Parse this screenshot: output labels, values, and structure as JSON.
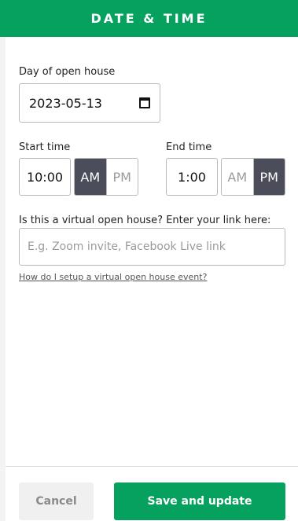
{
  "header": {
    "title": "DATE & TIME"
  },
  "day": {
    "label": "Day of open house",
    "value": "2023-05-13",
    "icon": "calendar-icon"
  },
  "start": {
    "label": "Start time",
    "value": "10:00",
    "am_label": "AM",
    "pm_label": "PM",
    "selected": "AM"
  },
  "end": {
    "label": "End time",
    "value": "1:00",
    "am_label": "AM",
    "pm_label": "PM",
    "selected": "PM"
  },
  "virtual": {
    "label": "Is this a virtual open house? Enter your link here:",
    "placeholder": "E.g. Zoom invite, Facebook Live link",
    "value": "",
    "help_link": "How do I setup a virtual open house event?"
  },
  "footer": {
    "cancel_label": "Cancel",
    "save_label": "Save and update"
  },
  "colors": {
    "brand": "#07a15f",
    "toggle_active": "#4b4d5b"
  }
}
